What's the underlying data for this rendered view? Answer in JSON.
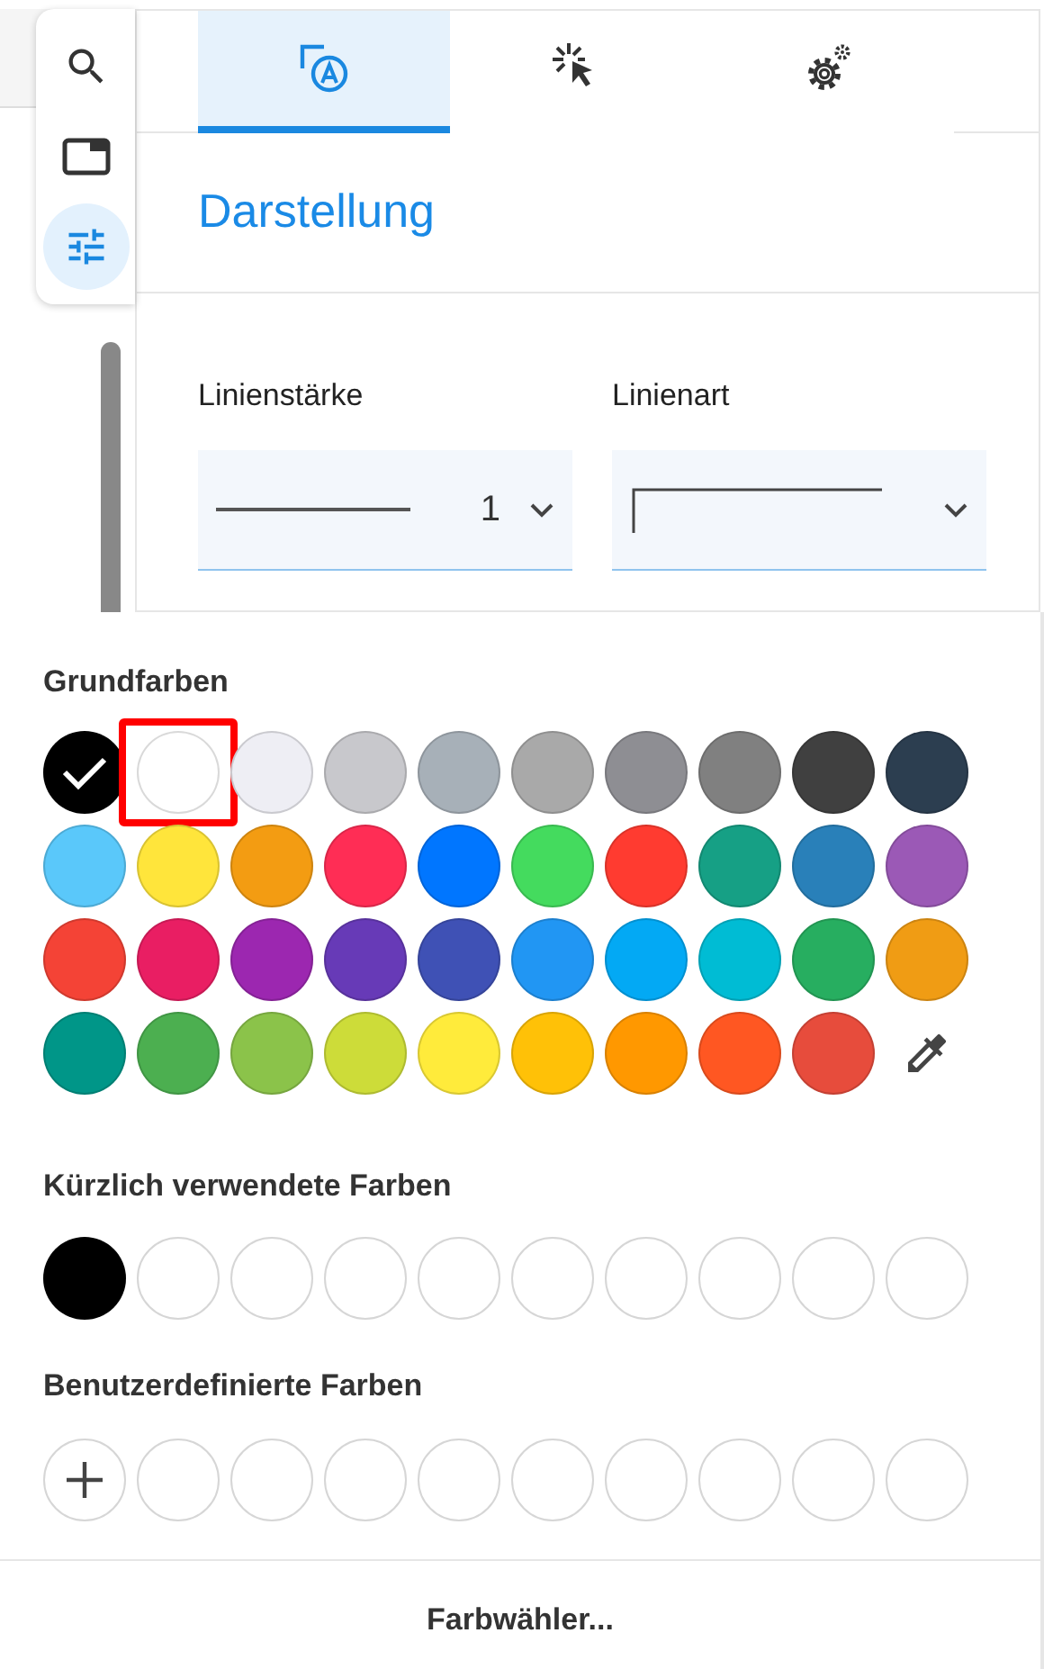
{
  "side_toolbar": [
    {
      "kind": "search",
      "selected": false
    },
    {
      "kind": "window",
      "selected": false
    },
    {
      "kind": "sliders",
      "selected": true
    }
  ],
  "tabs": [
    {
      "kind": "style",
      "selected": true
    },
    {
      "kind": "click",
      "selected": false
    },
    {
      "kind": "settings",
      "selected": false
    }
  ],
  "section_title": "Darstellung",
  "fields": [
    {
      "kind": "width",
      "label": "Linienstärke",
      "value": "1"
    },
    {
      "kind": "style",
      "label": "Linienart"
    }
  ],
  "palette": {
    "basic_title": "Grundfarben",
    "basic_colors": [
      {
        "color": "#000000",
        "selected": true,
        "focused": false
      },
      {
        "color": "#ffffff",
        "selected": false,
        "focused": true
      },
      {
        "color": "#eeeef4",
        "selected": false,
        "focused": false
      },
      {
        "color": "#c8c8cc",
        "selected": false,
        "focused": false
      },
      {
        "color": "#a7b0b8",
        "selected": false,
        "focused": false
      },
      {
        "color": "#a9a9a9",
        "selected": false,
        "focused": false
      },
      {
        "color": "#8e8e93",
        "selected": false,
        "focused": false
      },
      {
        "color": "#808080",
        "selected": false,
        "focused": false
      },
      {
        "color": "#404040",
        "selected": false,
        "focused": false
      },
      {
        "color": "#2c3e50",
        "selected": false,
        "focused": false
      },
      {
        "color": "#5ac8fa",
        "selected": false,
        "focused": false
      },
      {
        "color": "#ffe53b",
        "selected": false,
        "focused": false
      },
      {
        "color": "#f39c12",
        "selected": false,
        "focused": false
      },
      {
        "color": "#ff2d55",
        "selected": false,
        "focused": false
      },
      {
        "color": "#0076ff",
        "selected": false,
        "focused": false
      },
      {
        "color": "#44db5e",
        "selected": false,
        "focused": false
      },
      {
        "color": "#ff3b30",
        "selected": false,
        "focused": false
      },
      {
        "color": "#16a085",
        "selected": false,
        "focused": false
      },
      {
        "color": "#2980b9",
        "selected": false,
        "focused": false
      },
      {
        "color": "#9b59b6",
        "selected": false,
        "focused": false
      },
      {
        "color": "#f44336",
        "selected": false,
        "focused": false
      },
      {
        "color": "#e91e63",
        "selected": false,
        "focused": false
      },
      {
        "color": "#9c27b0",
        "selected": false,
        "focused": false
      },
      {
        "color": "#673ab7",
        "selected": false,
        "focused": false
      },
      {
        "color": "#3f51b5",
        "selected": false,
        "focused": false
      },
      {
        "color": "#2196f3",
        "selected": false,
        "focused": false
      },
      {
        "color": "#03a9f4",
        "selected": false,
        "focused": false
      },
      {
        "color": "#00bcd4",
        "selected": false,
        "focused": false
      },
      {
        "color": "#27ae60",
        "selected": false,
        "focused": false
      },
      {
        "color": "#f09c14",
        "selected": false,
        "focused": false
      },
      {
        "color": "#009688",
        "selected": false,
        "focused": false
      },
      {
        "color": "#4caf50",
        "selected": false,
        "focused": false
      },
      {
        "color": "#8bc34a",
        "selected": false,
        "focused": false
      },
      {
        "color": "#cddc39",
        "selected": false,
        "focused": false
      },
      {
        "color": "#ffeb3b",
        "selected": false,
        "focused": false
      },
      {
        "color": "#ffc107",
        "selected": false,
        "focused": false
      },
      {
        "color": "#ff9800",
        "selected": false,
        "focused": false
      },
      {
        "color": "#ff5722",
        "selected": false,
        "focused": false
      },
      {
        "color": "#e74c3c",
        "selected": false,
        "focused": false
      }
    ],
    "recent_title": "Kürzlich verwendete Farben",
    "recent_colors": [
      {
        "kind": "color",
        "color": "#000000"
      },
      {
        "kind": "empty"
      },
      {
        "kind": "empty"
      },
      {
        "kind": "empty"
      },
      {
        "kind": "empty"
      },
      {
        "kind": "empty"
      },
      {
        "kind": "empty"
      },
      {
        "kind": "empty"
      },
      {
        "kind": "empty"
      },
      {
        "kind": "empty"
      }
    ],
    "custom_title": "Benutzerdefinierte Farben",
    "custom_colors": [
      {
        "kind": "add"
      },
      {
        "kind": "empty"
      },
      {
        "kind": "empty"
      },
      {
        "kind": "empty"
      },
      {
        "kind": "empty"
      },
      {
        "kind": "empty"
      },
      {
        "kind": "empty"
      },
      {
        "kind": "empty"
      },
      {
        "kind": "empty"
      },
      {
        "kind": "empty"
      }
    ],
    "picker_button": "Farbwähler..."
  }
}
